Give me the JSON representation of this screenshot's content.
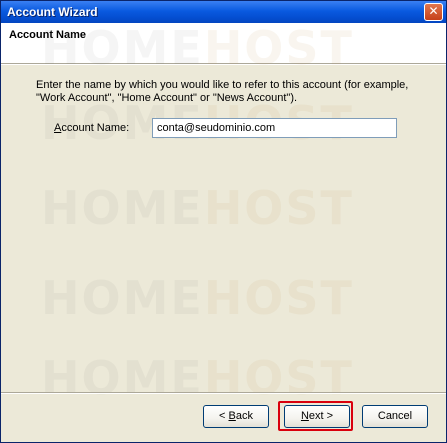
{
  "window": {
    "title": "Account Wizard",
    "close_glyph": "✕"
  },
  "header": {
    "title": "Account Name"
  },
  "watermark": {
    "home": "HOME",
    "host": "HOST"
  },
  "main": {
    "description": "Enter the name by which you would like to refer to this account (for example, \"Work Account\", \"Home Account\" or \"News Account\").",
    "account_name_label_prefix": "",
    "account_name_label_mnemonic": "A",
    "account_name_label_rest": "ccount Name:",
    "account_name_value": "conta@seudominio.com"
  },
  "footer": {
    "back_mnemonic": "B",
    "back_prefix": "< ",
    "back_rest": "ack",
    "next_mnemonic": "N",
    "next_rest": "ext >",
    "cancel_label": "Cancel"
  },
  "colors": {
    "titlebar": "#0a5ae0",
    "dialog_bg": "#ece9d8",
    "highlight": "#d9000d"
  }
}
